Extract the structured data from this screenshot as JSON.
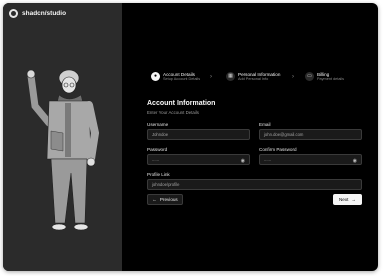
{
  "app": {
    "brand_name": "shadcn/studio"
  },
  "stepper": {
    "steps": [
      {
        "title": "Account Details",
        "description": "Setup Account Details",
        "icon": "user-icon",
        "state": "active"
      },
      {
        "title": "Personal Information",
        "description": "Add Personal Info",
        "icon": "id-card-icon",
        "state": "idle"
      },
      {
        "title": "Billing",
        "description": "Payment details",
        "icon": "credit-card-icon",
        "state": "idle"
      }
    ]
  },
  "form": {
    "title": "Account Information",
    "subtitle": "Enter Your Account Details",
    "username": {
      "label": "Username",
      "value": "Johndoe"
    },
    "email": {
      "label": "Email",
      "value": "john.doe@gmail.com"
    },
    "password": {
      "label": "Password",
      "value": "......"
    },
    "confirm_password": {
      "label": "Confirm Password",
      "value": "......"
    },
    "profile_link": {
      "label": "Profile Link",
      "value": "johndoe/profile"
    }
  },
  "buttons": {
    "previous": "Previous",
    "next": "Next"
  },
  "colors": {
    "panel": "#2b2b2b",
    "background": "#000000",
    "accent": "#f5f5f5"
  }
}
